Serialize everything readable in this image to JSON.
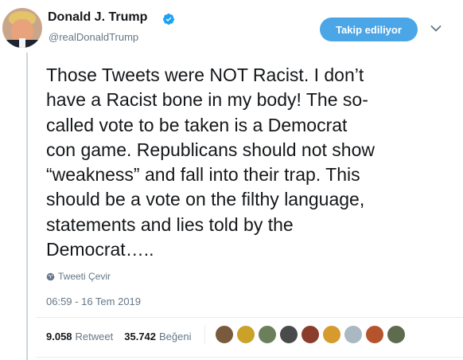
{
  "user": {
    "display_name": "Donald J. Trump",
    "handle": "@realDonaldTrump",
    "verified": true
  },
  "follow_button": {
    "label": "Takip ediliyor"
  },
  "tweet": {
    "text": "Those Tweets were NOT Racist. I don’t\nhave a Racist bone in my body! The so-\ncalled vote to be taken is a Democrat\ncon game. Republicans should not show\n“weakness” and fall into their trap. This\nshould be a vote on the filthy language,\nstatements and lies told by the\nDemocrat….."
  },
  "translate": {
    "label": "Tweeti Çevir",
    "icon": "globe-icon"
  },
  "timestamp": "06:59 - 16 Tem 2019",
  "stats": {
    "retweets": "9.058",
    "retweets_label": "Retweet",
    "likes": "35.742",
    "likes_label": "Beğeni"
  },
  "colors": {
    "accent": "#4aa6e6",
    "secondary_text": "#657786",
    "primary_text": "#14171a",
    "thread_line": "#ccd6dd"
  },
  "likers": [
    {
      "color": "#7a5a3c"
    },
    {
      "color": "#c9a227"
    },
    {
      "color": "#6b7f5a"
    },
    {
      "color": "#4a4a4a"
    },
    {
      "color": "#8a3d2b"
    },
    {
      "color": "#d69a2d"
    },
    {
      "color": "#aab8c2"
    },
    {
      "color": "#b5532c"
    },
    {
      "color": "#5e6b4d"
    }
  ]
}
